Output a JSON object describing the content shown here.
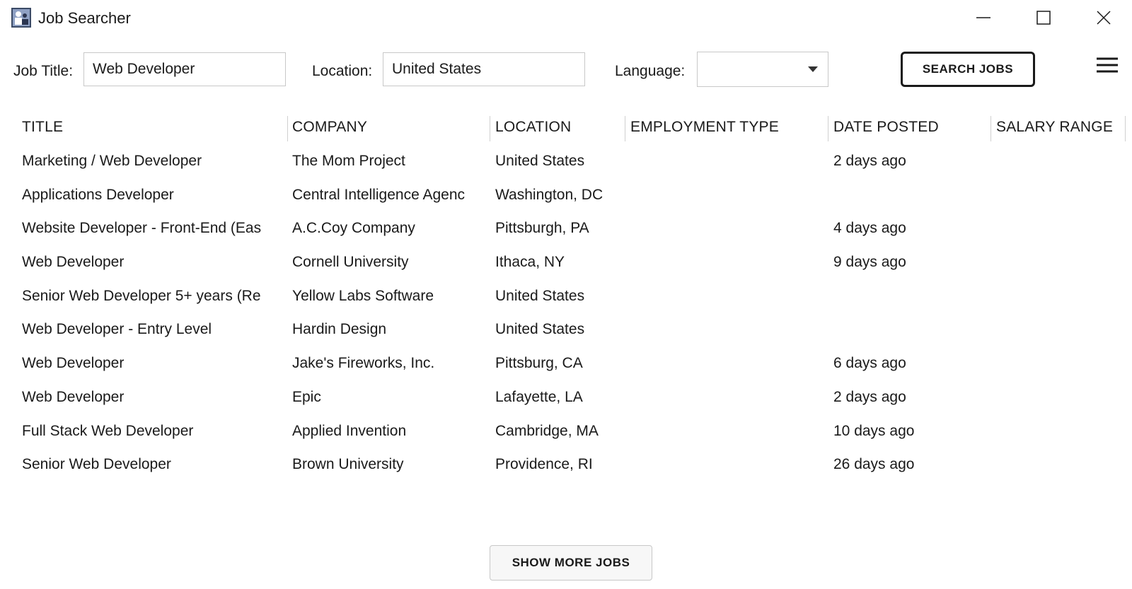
{
  "window": {
    "title": "Job Searcher"
  },
  "colors": {
    "text": "#1a1a1a",
    "border": "#c8c8c8",
    "button_border": "#1a1a1a",
    "background": "#ffffff"
  },
  "search": {
    "job_title_label": "Job Title:",
    "job_title_value": "Web Developer",
    "location_label": "Location:",
    "location_value": "United States",
    "language_label": "Language:",
    "language_value": "",
    "search_button": "SEARCH JOBS"
  },
  "table": {
    "headers": [
      "TITLE",
      "COMPANY",
      "LOCATION",
      "EMPLOYMENT TYPE",
      "DATE POSTED",
      "SALARY RANGE"
    ],
    "rows": [
      {
        "title": "Marketing / Web Developer",
        "company": "The Mom Project",
        "location": "United States",
        "employment_type": "",
        "date_posted": "2 days ago",
        "salary_range": ""
      },
      {
        "title": "Applications Developer",
        "company": "Central Intelligence Agenc",
        "location": "Washington, DC",
        "employment_type": "",
        "date_posted": "",
        "salary_range": ""
      },
      {
        "title": "Website Developer - Front-End (Eas",
        "company": "A.C.Coy Company",
        "location": "Pittsburgh, PA",
        "employment_type": "",
        "date_posted": "4 days ago",
        "salary_range": ""
      },
      {
        "title": "Web Developer",
        "company": "Cornell University",
        "location": "Ithaca, NY",
        "employment_type": "",
        "date_posted": "9 days ago",
        "salary_range": ""
      },
      {
        "title": "Senior Web Developer 5+ years (Re",
        "company": "Yellow Labs Software",
        "location": "United States",
        "employment_type": "",
        "date_posted": "",
        "salary_range": ""
      },
      {
        "title": "Web Developer - Entry Level",
        "company": "Hardin Design",
        "location": "United States",
        "employment_type": "",
        "date_posted": "",
        "salary_range": ""
      },
      {
        "title": "Web Developer",
        "company": "Jake's Fireworks, Inc.",
        "location": "Pittsburg, CA",
        "employment_type": "",
        "date_posted": "6 days ago",
        "salary_range": ""
      },
      {
        "title": "Web Developer",
        "company": "Epic",
        "location": "Lafayette, LA",
        "employment_type": "",
        "date_posted": "2 days ago",
        "salary_range": ""
      },
      {
        "title": "Full Stack Web Developer",
        "company": "Applied Invention",
        "location": "Cambridge, MA",
        "employment_type": "",
        "date_posted": "10 days ago",
        "salary_range": ""
      },
      {
        "title": "Senior Web Developer",
        "company": "Brown University",
        "location": "Providence, RI",
        "employment_type": "",
        "date_posted": "26 days ago",
        "salary_range": ""
      }
    ]
  },
  "footer": {
    "show_more_button": "SHOW MORE JOBS"
  },
  "icons": {
    "app": "app-icon",
    "minimize": "minimize-icon",
    "maximize": "maximize-icon",
    "close": "close-icon",
    "dropdown": "chevron-down-icon",
    "menu": "hamburger-menu-icon"
  }
}
